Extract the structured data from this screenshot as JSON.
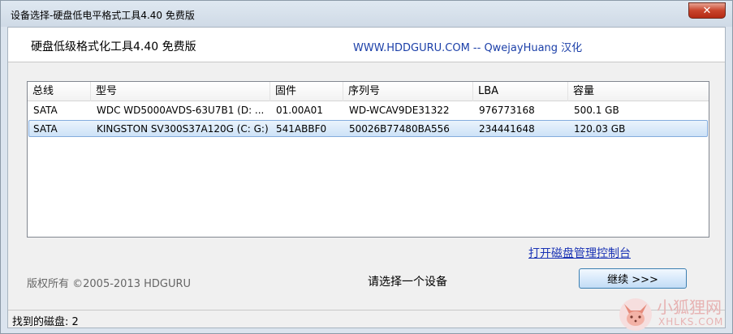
{
  "window": {
    "title": "设备选择-硬盘低电平格式工具4.40   免费版",
    "close_label": "✕"
  },
  "header": {
    "app_title": "硬盘低级格式化工具4.40   免费版",
    "credit": "WWW.HDDGURU.COM -- QwejayHuang 汉化"
  },
  "table": {
    "columns": [
      "总线",
      "型号",
      "固件",
      "序列号",
      "LBA",
      "容量"
    ],
    "rows": [
      {
        "bus": "SATA",
        "model": "WDC WD5000AVDS-63U7B1 (D: ...",
        "firmware": "01.00A01",
        "serial": "WD-WCAV9DE31322",
        "lba": "976773168",
        "capacity": "500.1 GB"
      },
      {
        "bus": "SATA",
        "model": "KINGSTON SV300S37A120G (C: G:)",
        "firmware": "541ABBF0",
        "serial": "50026B77480BA556",
        "lba": "234441648",
        "capacity": "120.03 GB"
      }
    ]
  },
  "links": {
    "disk_management": "打开磁盘管理控制台"
  },
  "footer": {
    "copyright": "版权所有 ©2005-2013 HDGURU",
    "prompt": "请选择一个设备",
    "continue_label": "继续 >>>"
  },
  "status": {
    "found": "找到的磁盘: 2"
  },
  "watermark": {
    "text": "小狐狸网",
    "sub": "XHLKS.COM"
  }
}
